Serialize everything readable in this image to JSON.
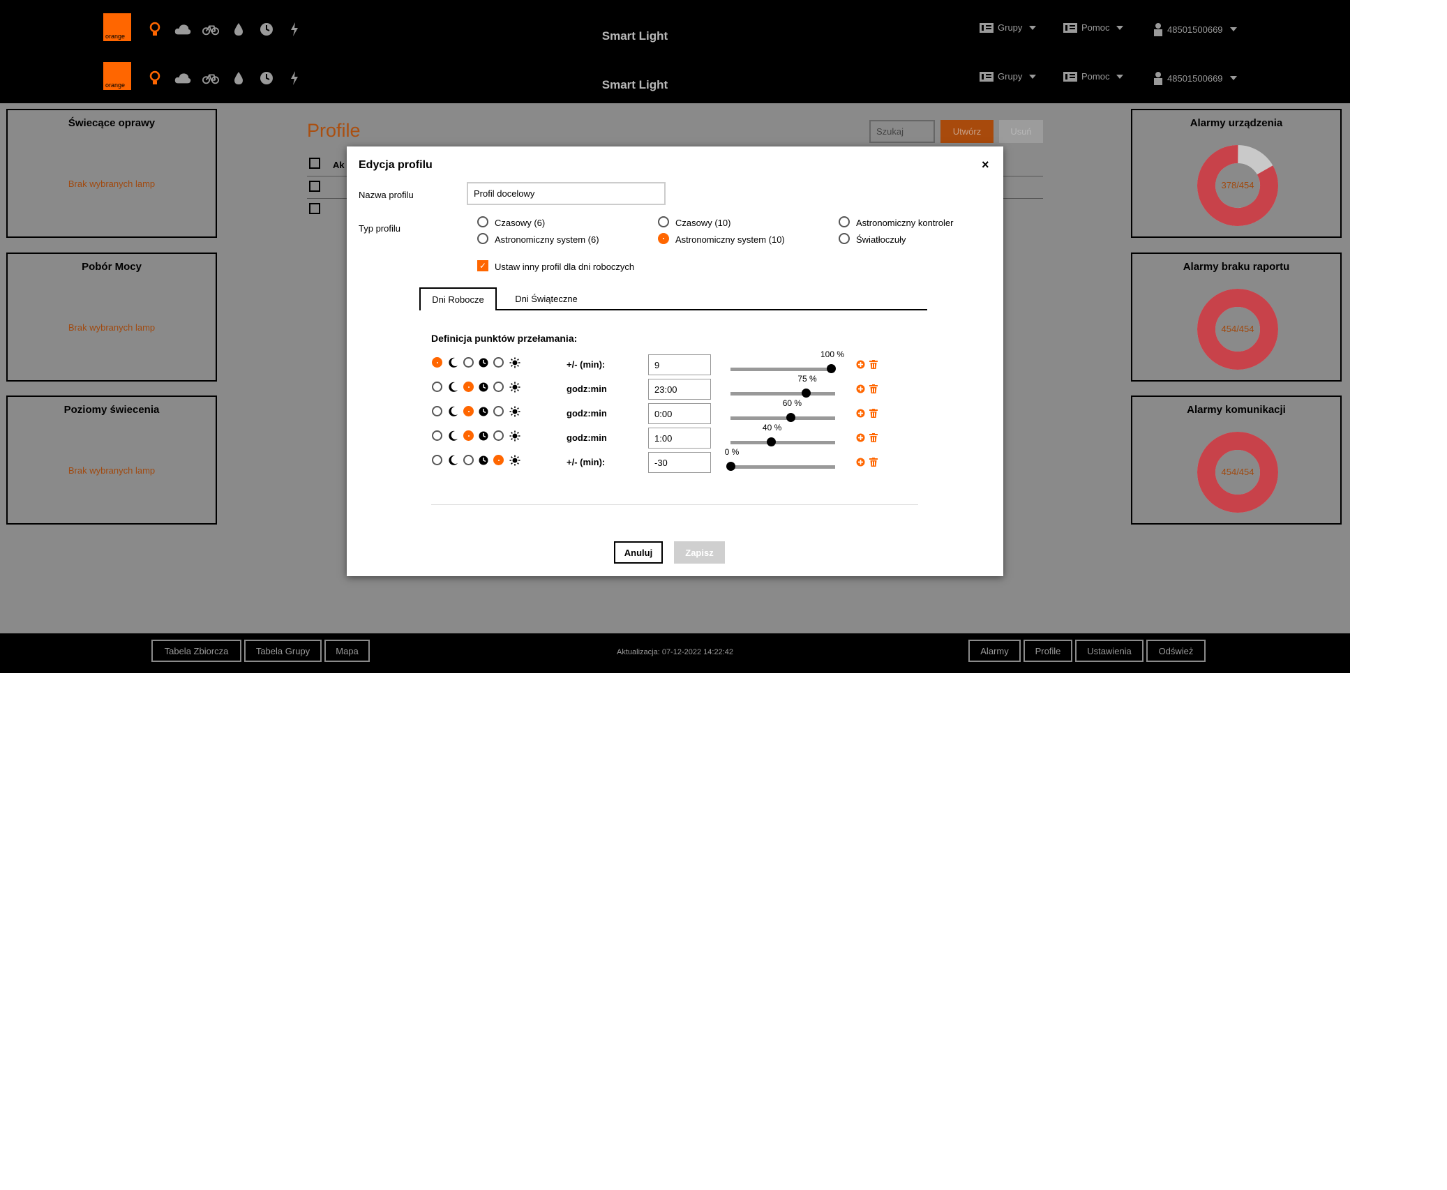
{
  "header": {
    "brand": "orange",
    "title": "Smart Light",
    "icons": [
      "bulb-icon",
      "cloud-icon",
      "bike-icon",
      "drop-icon",
      "clock-icon",
      "bolt-icon"
    ],
    "menu": {
      "groups": "Grupy",
      "help": "Pomoc",
      "user": "48501500669"
    }
  },
  "left_panels": [
    {
      "title": "Świecące oprawy",
      "text": "Brak wybranych lamp"
    },
    {
      "title": "Pobór Mocy",
      "text": "Brak wybranych lamp"
    },
    {
      "title": "Poziomy świecenia",
      "text": "Brak wybranych lamp"
    }
  ],
  "right_panels": [
    {
      "title": "Alarmy urządzenia",
      "label": "378/454",
      "fraction": 0.8326
    },
    {
      "title": "Alarmy braku raportu",
      "label": "454/454",
      "fraction": 1.0
    },
    {
      "title": "Alarmy komunikacji",
      "label": "454/454",
      "fraction": 1.0
    }
  ],
  "page": {
    "title": "Profile",
    "search_placeholder": "Szukaj",
    "create_label": "Utwórz",
    "delete_label": "Usuń",
    "col_actions": "Ak"
  },
  "modal": {
    "title": "Edycja profilu",
    "close": "×",
    "name_label": "Nazwa profilu",
    "name_value": "Profil docelowy",
    "type_label": "Typ profilu",
    "type_options": [
      {
        "label": "Czasowy (6)",
        "selected": false
      },
      {
        "label": "Czasowy (10)",
        "selected": false
      },
      {
        "label": "Astronomiczny kontroler",
        "selected": false
      },
      {
        "label": "Astronomiczny system (6)",
        "selected": false
      },
      {
        "label": "Astronomiczny system (10)",
        "selected": true
      },
      {
        "label": "Światłoczuły",
        "selected": false
      }
    ],
    "workdays_checkbox": "Ustaw inny profil dla dni roboczych",
    "workdays_checked": true,
    "tabs": [
      "Dni Robocze",
      "Dni Świąteczne"
    ],
    "active_tab": 0,
    "breakpoints_title": "Definicja punktów przełamania:",
    "breakpoints": [
      {
        "selected": 0,
        "mode": "+/- (min):",
        "value": "9",
        "percent_label": "100 %",
        "level": 100
      },
      {
        "selected": 1,
        "mode": "godz:min",
        "value": "23:00",
        "percent_label": "75 %",
        "level": 75
      },
      {
        "selected": 1,
        "mode": "godz:min",
        "value": "0:00",
        "percent_label": "60 %",
        "level": 60
      },
      {
        "selected": 1,
        "mode": "godz:min",
        "value": "1:00",
        "percent_label": "40 %",
        "level": 40
      },
      {
        "selected": 2,
        "mode": "+/- (min):",
        "value": "-30",
        "percent_label": "0 %",
        "level": 0
      }
    ],
    "cancel_label": "Anuluj",
    "save_label": "Zapisz"
  },
  "footer": {
    "left_buttons": [
      "Tabela Zbiorcza",
      "Tabela Grupy",
      "Mapa"
    ],
    "updated": "Aktualizacja: 07-12-2022 14:22:42",
    "right_buttons": [
      "Alarmy",
      "Profile",
      "Ustawienia",
      "Odśwież"
    ]
  },
  "colors": {
    "accent": "#ff6600",
    "alarm": "#c8424a",
    "donut_rest": "#c9c9c9",
    "overlay_bg": "#8a8a8a"
  }
}
